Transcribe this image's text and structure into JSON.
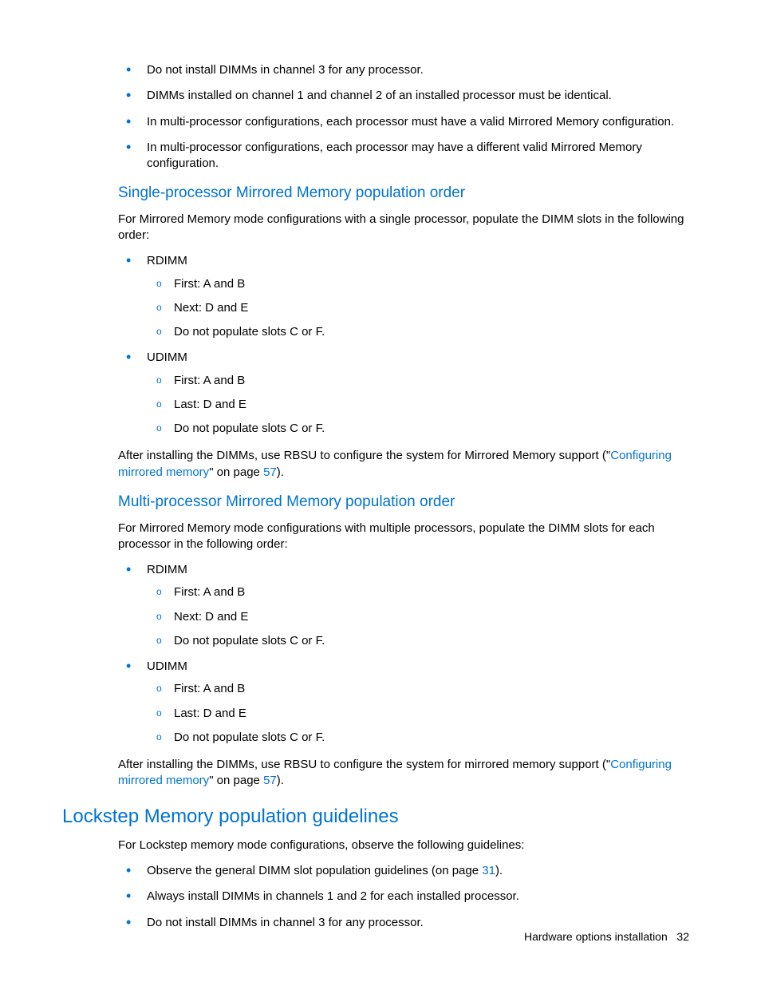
{
  "topBullets": [
    "Do not install DIMMs in channel 3 for any processor.",
    "DIMMs installed on channel 1 and channel 2 of an installed processor must be identical.",
    "In multi-processor configurations, each processor must have a valid Mirrored Memory configuration.",
    "In multi-processor configurations, each processor may have a different valid Mirrored Memory configuration."
  ],
  "single": {
    "heading": "Single-processor Mirrored Memory population order",
    "intro": "For Mirrored Memory mode configurations with a single processor, populate the DIMM slots in the following order:",
    "items": [
      {
        "label": "RDIMM",
        "subs": [
          "First: A and B",
          "Next: D and E",
          "Do not populate slots C or F."
        ]
      },
      {
        "label": "UDIMM",
        "subs": [
          "First: A and B",
          "Last: D and E",
          "Do not populate slots C or F."
        ]
      }
    ],
    "after_pre": "After installing the DIMMs, use RBSU to configure the system for Mirrored Memory support (\"",
    "after_link": "Configuring mirrored memory",
    "after_mid": "\" on page ",
    "after_page": "57",
    "after_post": ")."
  },
  "multi": {
    "heading": "Multi-processor Mirrored Memory population order",
    "intro": "For Mirrored Memory mode configurations with multiple processors, populate the DIMM slots for each processor in the following order:",
    "items": [
      {
        "label": "RDIMM",
        "subs": [
          "First: A and B",
          "Next: D and E",
          "Do not populate slots C or F."
        ]
      },
      {
        "label": "UDIMM",
        "subs": [
          "First: A and B",
          "Last: D and E",
          "Do not populate slots C or F."
        ]
      }
    ],
    "after_pre": "After installing the DIMMs, use RBSU to configure the system for mirrored memory support (\"",
    "after_link": "Configuring mirrored memory",
    "after_mid": "\" on page ",
    "after_page": "57",
    "after_post": ")."
  },
  "lockstep": {
    "heading": "Lockstep Memory population guidelines",
    "intro": "For Lockstep memory mode configurations, observe the following guidelines:",
    "b1_pre": "Observe the general DIMM slot population guidelines (on page ",
    "b1_page": "31",
    "b1_post": ").",
    "b2": "Always install DIMMs in channels 1 and 2 for each installed processor.",
    "b3": "Do not install DIMMs in channel 3 for any processor."
  },
  "footer": {
    "text": "Hardware options installation",
    "page": "32"
  }
}
